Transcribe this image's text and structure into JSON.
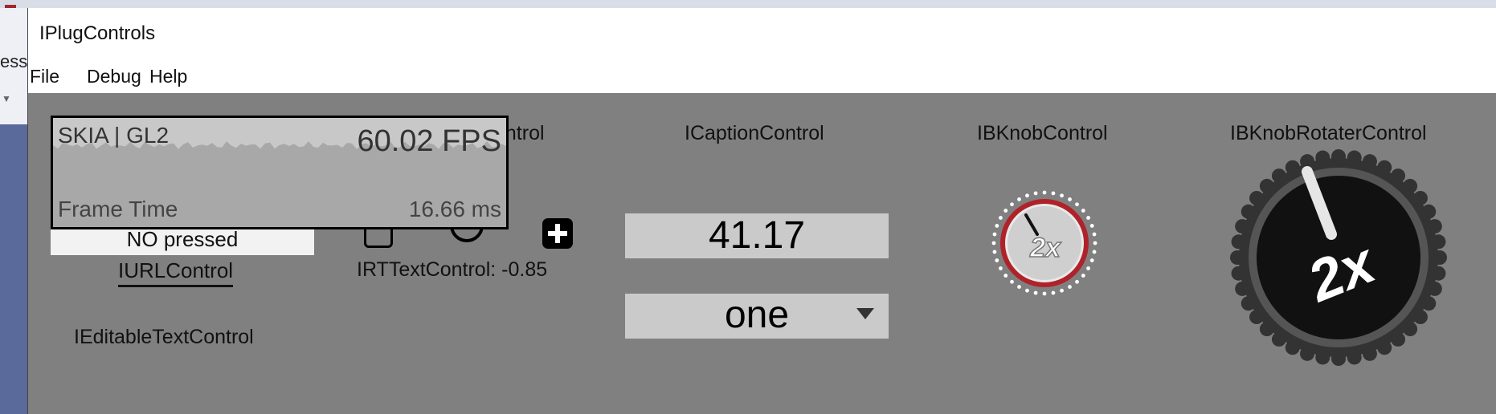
{
  "window": {
    "title": "IPlugControls"
  },
  "background": {
    "side_text": "ess"
  },
  "menu": {
    "file": "File",
    "debug": "Debug",
    "help": "Help"
  },
  "labels": {
    "control_partial": "ontrol",
    "caption_control": "ICaptionControl",
    "bknob_control": "IBKnobControl",
    "bknob_rotater_control": "IBKnobRotaterControl",
    "url_control": "IURLControl",
    "rt_text_control": "IRTTextControl: -0.85",
    "editable_text_control": "IEditableTextControl"
  },
  "perf": {
    "renderer": "SKIA | GL2",
    "fps": "60.02 FPS",
    "frame_time_label": "Frame Time",
    "frame_time_value": "16.66 ms"
  },
  "button": {
    "label": "NO pressed"
  },
  "caption": {
    "value": "41.17"
  },
  "list": {
    "selected": "one"
  },
  "knobs": {
    "small_label": "2x",
    "large_label": "2x"
  },
  "colors": {
    "canvas": "#808080",
    "value_box": "#cacaca",
    "knob_red": "#b0222a"
  }
}
